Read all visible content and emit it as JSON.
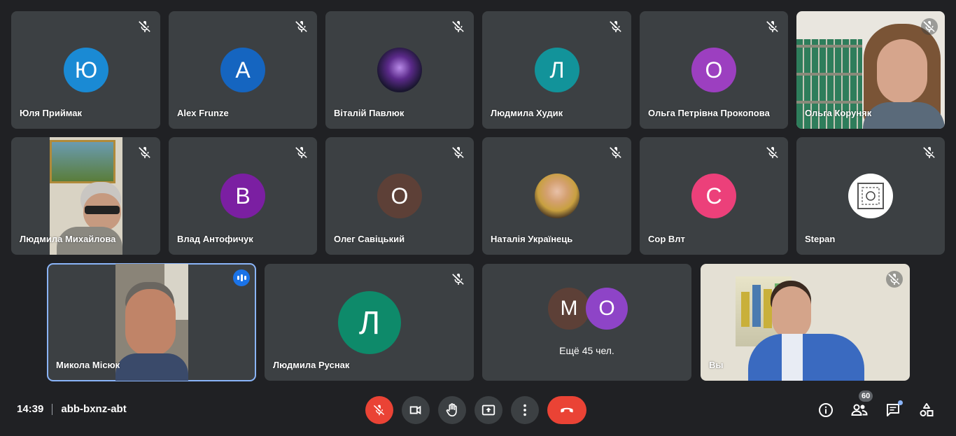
{
  "participants": {
    "p1": {
      "name": "Юля Приймак",
      "initial": "Ю",
      "color": "#1a8ad4"
    },
    "p2": {
      "name": "Alex Frunze",
      "initial": "A",
      "color": "#1565c0"
    },
    "p3": {
      "name": "Віталій Павлюк"
    },
    "p4": {
      "name": "Людмила Худик",
      "initial": "Л",
      "color": "#12939a"
    },
    "p5": {
      "name": "Ольга Петрівна Прокопова",
      "initial": "О",
      "color": "#9c3fc0"
    },
    "p6": {
      "name": "Ольга Коруняк"
    },
    "p7": {
      "name": "Людмила Михайлова"
    },
    "p8": {
      "name": "Влад Антофичук",
      "initial": "В",
      "color": "#7b1fa2"
    },
    "p9": {
      "name": "Олег Савіцький",
      "initial": "О",
      "color": "#5d4037"
    },
    "p10": {
      "name": "Наталія Українець"
    },
    "p11": {
      "name": "Сор Влт",
      "initial": "С",
      "color": "#ec407a"
    },
    "p12": {
      "name": "Stepan"
    },
    "p13": {
      "name": "Микола Місюк"
    },
    "p14": {
      "name": "Людмила Руснак",
      "initial": "Л",
      "color": "#0e8a6a"
    },
    "others": {
      "initial_1": "М",
      "color_1": "#5d4037",
      "initial_2": "О",
      "color_2": "#8e44c7",
      "label": "Ещё 45 чел."
    },
    "self": {
      "name": "Вы"
    }
  },
  "meeting": {
    "time": "14:39",
    "code": "abb-bxnz-abt"
  },
  "controls": {
    "mic": "mic-off-icon",
    "camera": "camera-icon",
    "hand": "raise-hand-icon",
    "present": "present-screen-icon",
    "more": "more-options-icon",
    "leave": "hang-up-icon"
  },
  "sidebar_actions": {
    "participants_count": "60"
  },
  "colors": {
    "background": "#202124",
    "tile": "#3c4043",
    "danger": "#ea4335",
    "accent": "#8ab4f8"
  }
}
